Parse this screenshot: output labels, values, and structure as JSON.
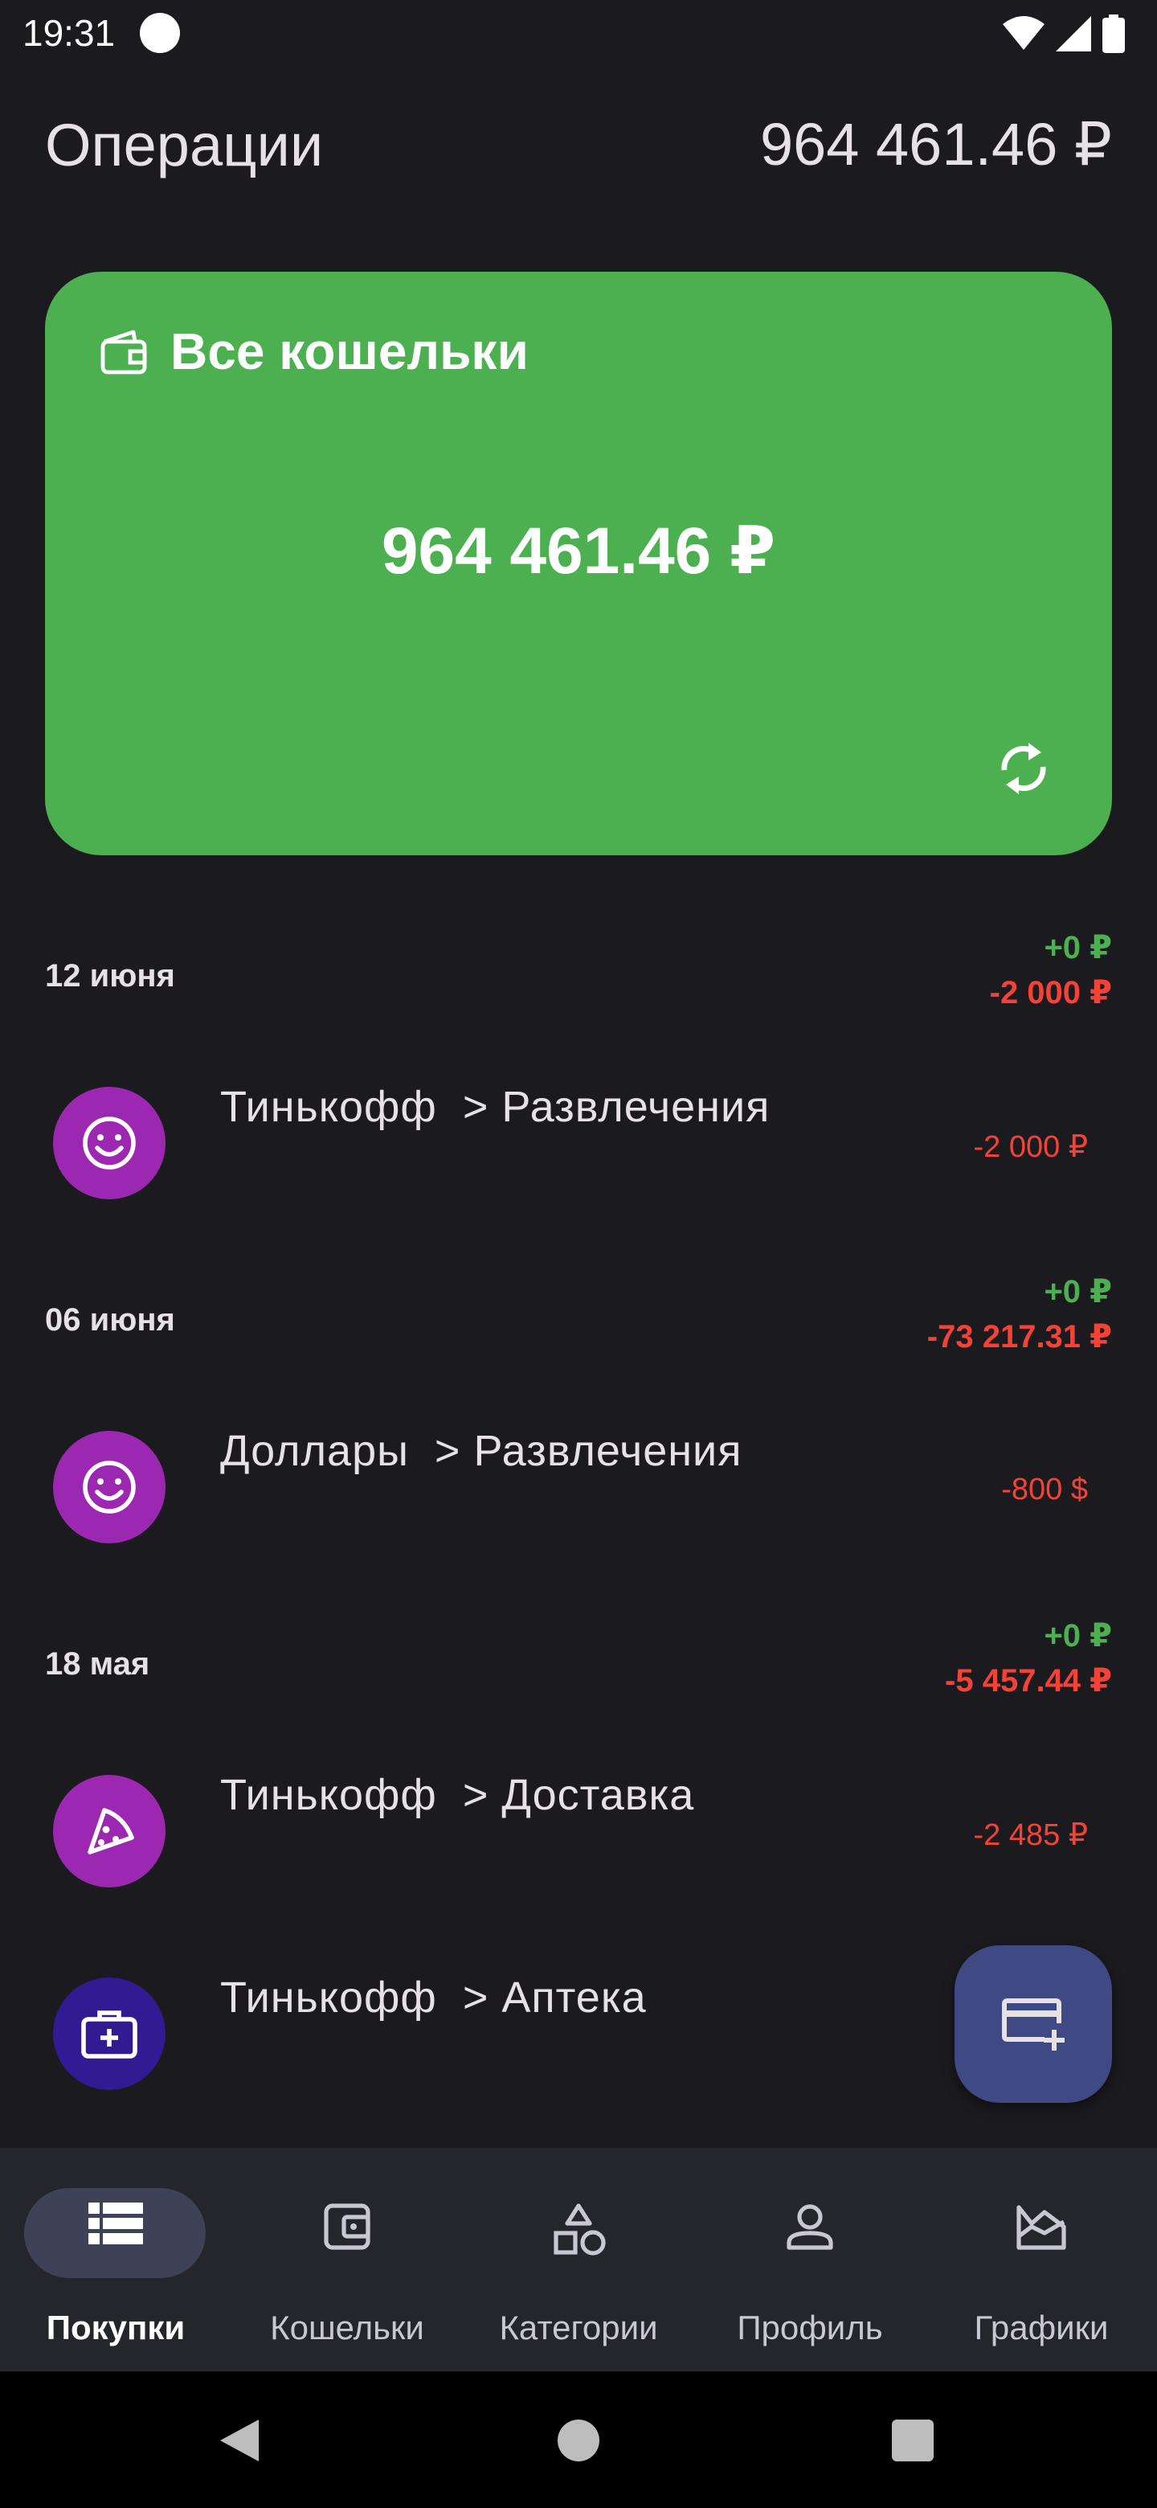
{
  "status_bar": {
    "time": "19:31"
  },
  "header": {
    "title": "Операции",
    "total": "964 461.46 ₽"
  },
  "wallet_card": {
    "name": "Все кошельки",
    "amount": "964 461.46 ₽",
    "color": "#4caf50"
  },
  "days": [
    {
      "date": "12 июня",
      "income": "+0 ₽",
      "expense": "-2 000 ₽",
      "operations": [
        {
          "title": "Тинькофф  > Развлечения",
          "amount": "-2 000 ₽",
          "icon": "smile-icon",
          "color": "#9c27b0"
        }
      ]
    },
    {
      "date": "06 июня",
      "income": "+0 ₽",
      "expense": "-73 217.31 ₽",
      "operations": [
        {
          "title": "Доллары  > Развлечения",
          "amount": "-800 $",
          "icon": "smile-icon",
          "color": "#9c27b0"
        }
      ]
    },
    {
      "date": "18 мая",
      "income": "+0 ₽",
      "expense": "-5 457.44 ₽",
      "operations": [
        {
          "title": "Тинькофф  > Доставка",
          "amount": "-2 485 ₽",
          "icon": "pizza-icon",
          "color": "#9c27b0"
        },
        {
          "title": "Тинькофф  > Аптека",
          "amount": "-",
          "icon": "medical-kit-icon",
          "color": "#311b92"
        }
      ]
    }
  ],
  "fab": {
    "icon": "add-card-icon"
  },
  "bottom_nav": [
    {
      "label": "Покупки",
      "icon": "list-icon",
      "active": true
    },
    {
      "label": "Кошельки",
      "icon": "wallet-icon",
      "active": false
    },
    {
      "label": "Категории",
      "icon": "shapes-icon",
      "active": false
    },
    {
      "label": "Профиль",
      "icon": "person-icon",
      "active": false
    },
    {
      "label": "Графики",
      "icon": "chart-icon",
      "active": false
    }
  ],
  "colors": {
    "background": "#1b1b1f",
    "income": "#4caf50",
    "expense": "#f44336",
    "fab": "#3f4a85",
    "nav_active": "#3e4256"
  }
}
